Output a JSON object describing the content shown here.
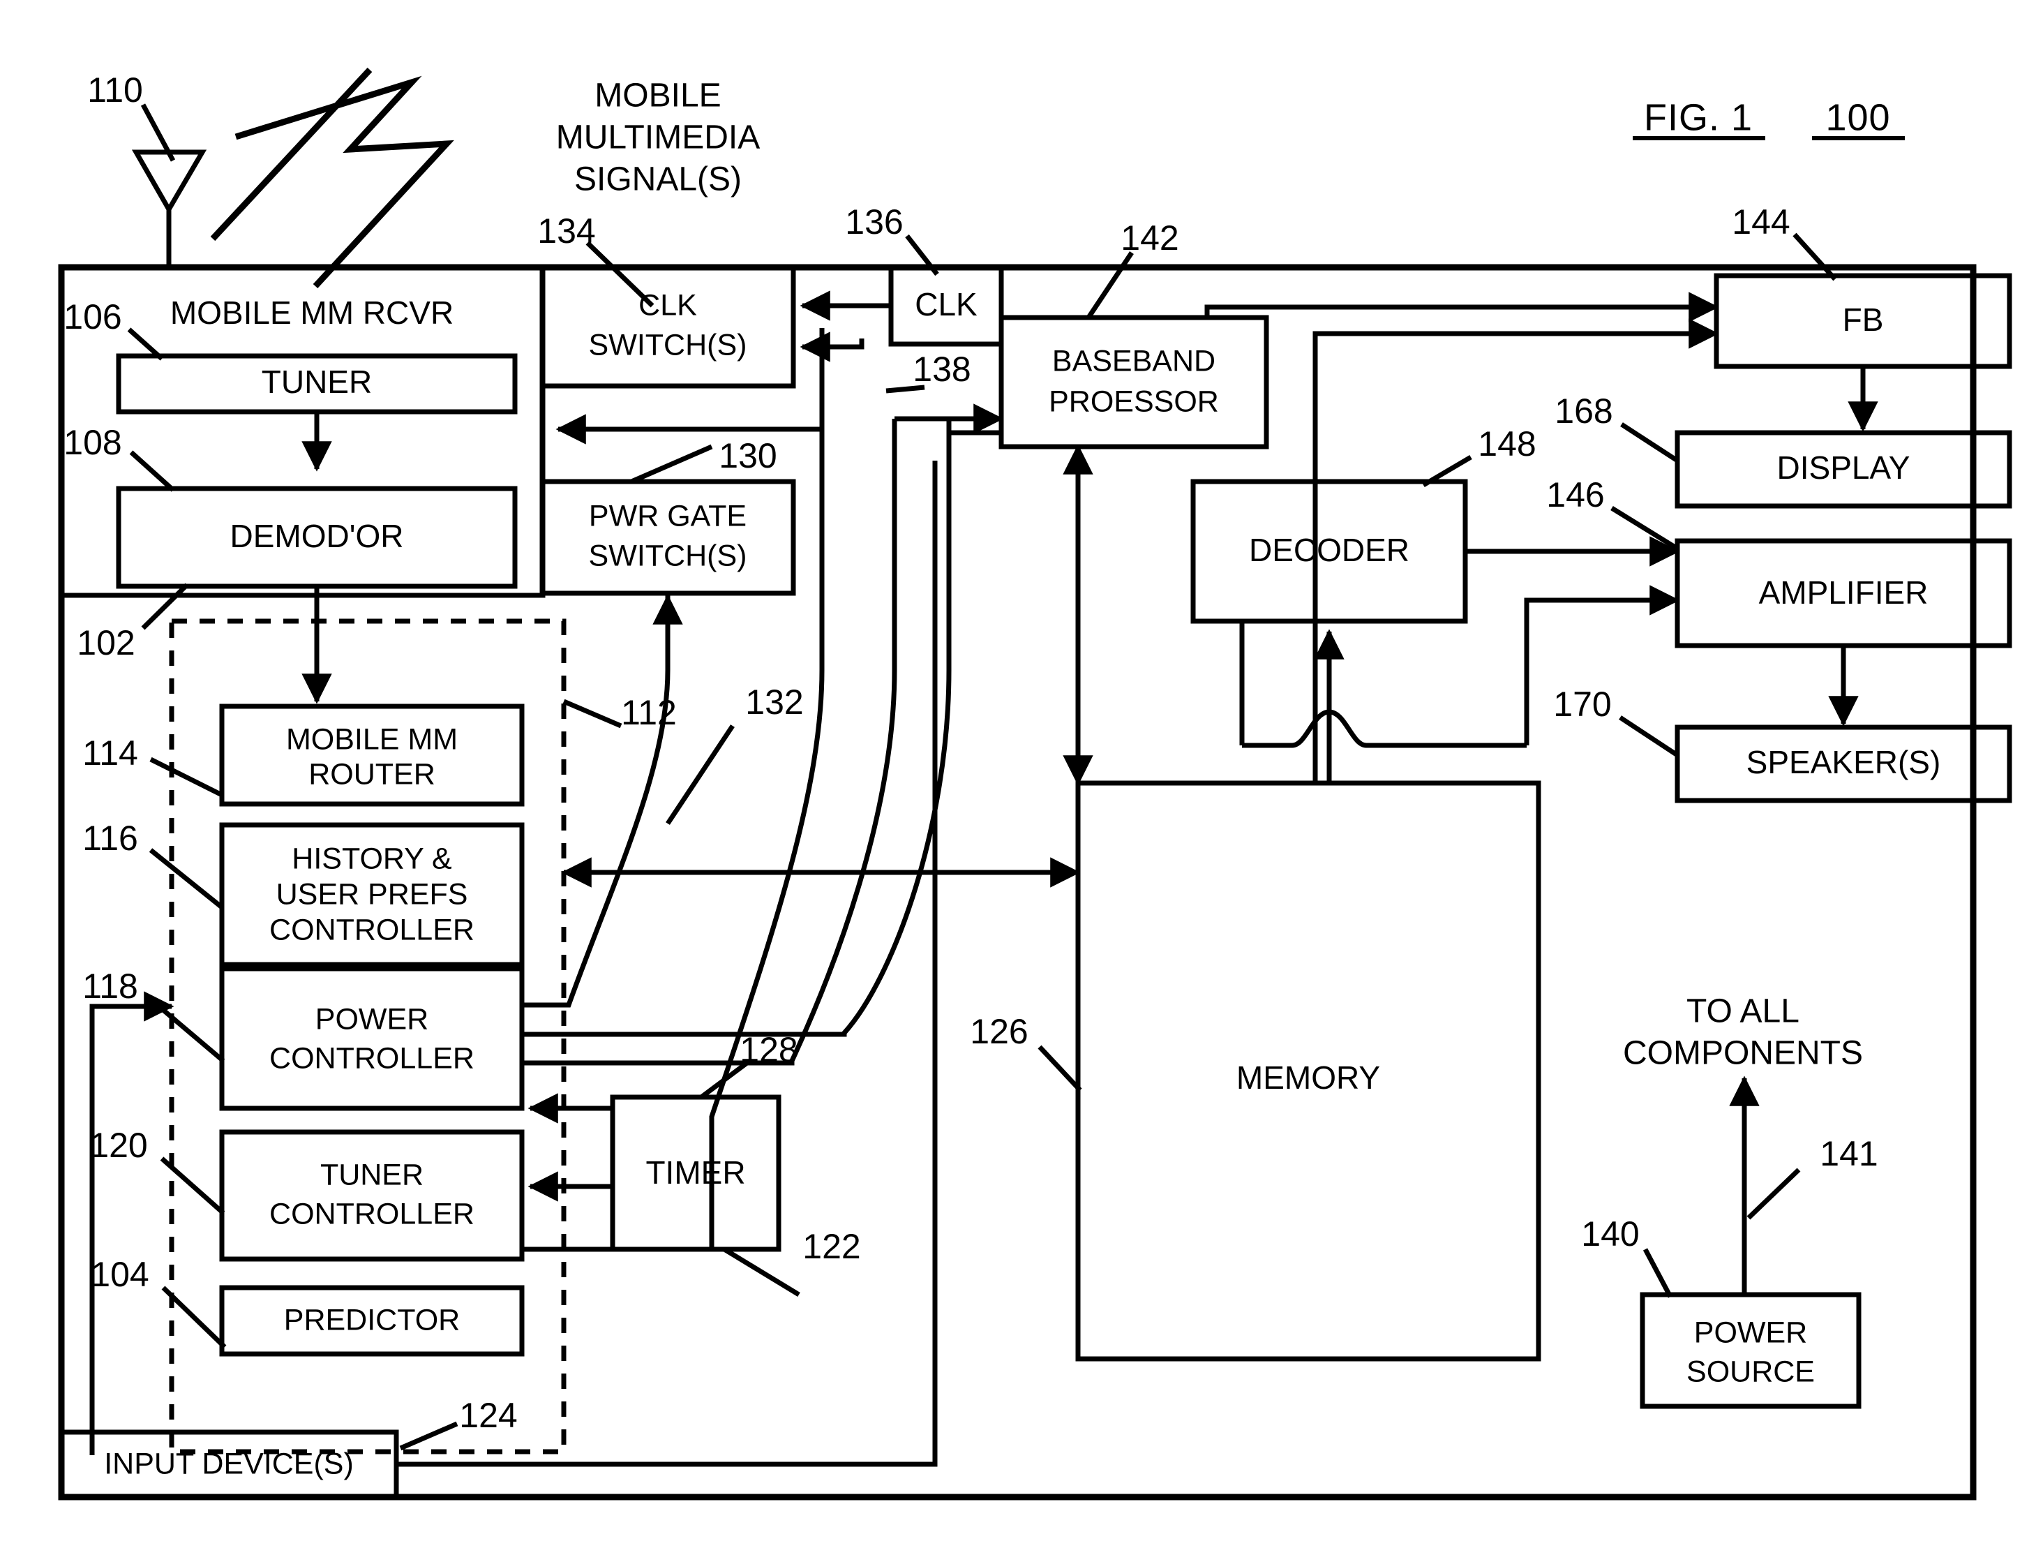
{
  "figure": {
    "fig_label": "FIG. 1",
    "fig_number": "100"
  },
  "free_labels": {
    "mm_signals_line1": "MOBILE",
    "mm_signals_line2": "MULTIMEDIA",
    "mm_signals_line3": "SIGNAL(S)",
    "to_all_line1": "TO ALL",
    "to_all_line2": "COMPONENTS"
  },
  "blocks": {
    "mobile_mm_rcvr": {
      "label": "MOBILE MM RCVR",
      "ref": ""
    },
    "tuner": {
      "label": "TUNER",
      "ref": "106"
    },
    "demodulator": {
      "label": "DEMOD'OR",
      "ref": "108"
    },
    "clk_switch": {
      "line1": "CLK",
      "line2": "SWITCH(S)",
      "ref": "134"
    },
    "clk": {
      "label": "CLK",
      "ref": "136"
    },
    "pwr_gate_switch": {
      "line1": "PWR GATE",
      "line2": "SWITCH(S)",
      "ref": "130"
    },
    "mobile_mm_router": {
      "line1": "MOBILE MM",
      "line2": "ROUTER",
      "ref": "114"
    },
    "history_user_prefs": {
      "line1": "HISTORY &",
      "line2": "USER PREFS",
      "line3": "CONTROLLER",
      "ref": "116"
    },
    "power_controller": {
      "line1": "POWER",
      "line2": "CONTROLLER",
      "ref": "118"
    },
    "tuner_controller": {
      "line1": "TUNER",
      "line2": "CONTROLLER",
      "ref": "120"
    },
    "predictor": {
      "label": "PREDICTOR",
      "ref": "104"
    },
    "timer": {
      "label": "TIMER",
      "ref": "128"
    },
    "baseband_processor": {
      "line1": "BASEBAND",
      "line2": "PROESSOR",
      "ref": "142"
    },
    "decoder": {
      "label": "DECODER",
      "ref": "148"
    },
    "memory": {
      "label": "MEMORY",
      "ref": "126"
    },
    "fb": {
      "label": "FB",
      "ref": "144"
    },
    "display": {
      "label": "DISPLAY",
      "ref": "168"
    },
    "amplifier": {
      "label": "AMPLIFIER",
      "ref": "146"
    },
    "speakers": {
      "label": "SPEAKER(S)",
      "ref": "170"
    },
    "power_source": {
      "line1": "POWER",
      "line2": "SOURCE",
      "ref": "140"
    },
    "input_devices": {
      "label": "INPUT DEVICE(S)",
      "ref": "124"
    }
  },
  "reference_numerals": {
    "antenna": "110",
    "tuner": "106",
    "demodulator": "108",
    "clk_switch": "134",
    "clk": "136",
    "pwr_gate_switch": "130",
    "controller_group": "102",
    "mobile_mm_router": "114",
    "history_user_prefs": "116",
    "power_controller": "118",
    "tuner_controller": "120",
    "predictor": "104",
    "bus_112": "112",
    "bus_132": "132",
    "bus_122": "122",
    "bus_138": "138",
    "timer": "128",
    "input_devices": "124",
    "baseband_processor": "142",
    "decoder": "148",
    "memory": "126",
    "fb": "144",
    "display": "168",
    "amplifier": "146",
    "speakers": "170",
    "power_source": "140",
    "power_bus": "141",
    "figure_number": "100"
  },
  "colors": {
    "ink": "#000000",
    "paper": "#ffffff"
  }
}
